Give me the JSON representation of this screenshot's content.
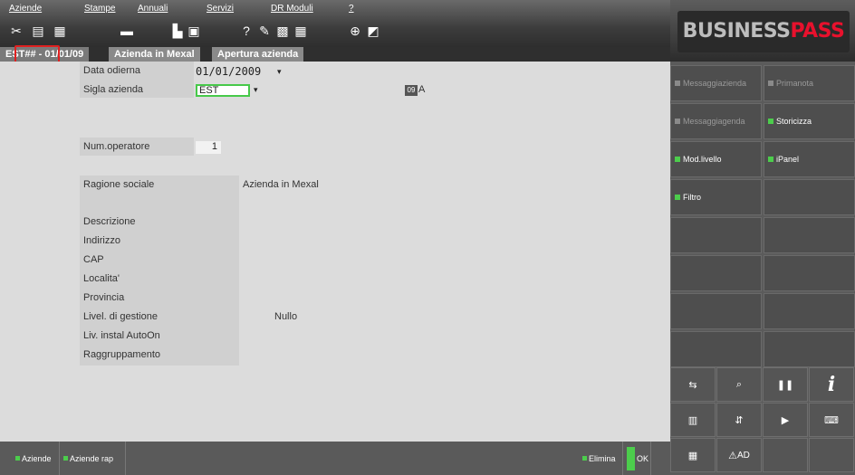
{
  "menu": [
    "Aziende",
    "Stampe",
    "Annuali",
    "Servizi",
    "DR Moduli",
    "?"
  ],
  "tabs": [
    "EST## - 01/01/09",
    "Azienda in Mexal",
    "Apertura azienda"
  ],
  "brand": {
    "part1": "BUSINESS",
    "part2": "PASS",
    "accent": "#e8112d"
  },
  "form": {
    "date_label": "Data odierna",
    "date_value": "01/01/2009",
    "sigla_label": "Sigla azienda",
    "sigla_value": "EST",
    "badge": "09",
    "badge_suffix": "A",
    "operatore_label": "Num.operatore",
    "operatore_value": "1",
    "ragione_label": "Ragione sociale",
    "ragione_value": "Azienda in Mexal",
    "descrizione_label": "Descrizione",
    "indirizzo_label": "Indirizzo",
    "cap_label": "CAP",
    "localita_label": "Localita'",
    "provincia_label": "Provincia",
    "gestione_label": "Livel. di gestione",
    "gestione_value": "Nullo",
    "autoon_label": "Liv. instal AutoOn",
    "raggruppamento_label": "Raggruppamento"
  },
  "right_buttons": [
    {
      "label": "Messaggiazienda",
      "active": false
    },
    {
      "label": "Primanota",
      "active": false
    },
    {
      "label": "Messaggiagenda",
      "active": false
    },
    {
      "label": "Storicizza",
      "active": true
    },
    {
      "label": "Mod.livello",
      "active": true
    },
    {
      "label": "iPanel",
      "active": true
    },
    {
      "label": "Filtro",
      "active": true
    }
  ],
  "icon_buttons": [
    "ad-icon"
  ],
  "icon_text": {
    "ad": "AD"
  },
  "bottom_buttons": {
    "aziende": "Aziende",
    "aziende_rap": "Aziende rap",
    "elimina": "Elimina",
    "ok": "OK"
  }
}
